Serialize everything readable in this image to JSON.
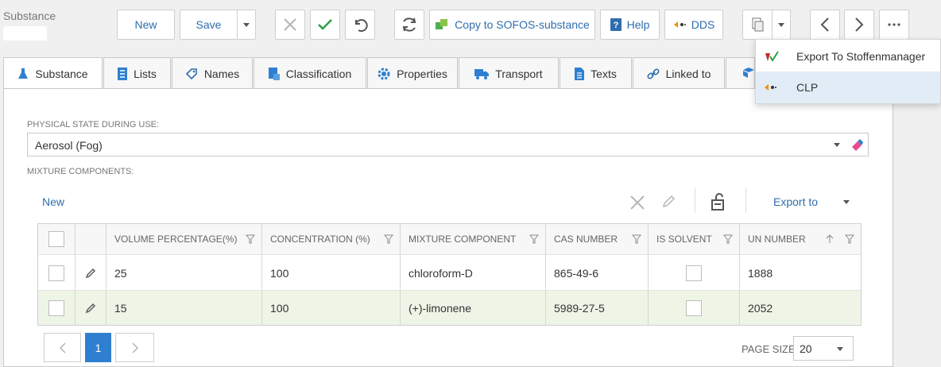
{
  "breadcrumb": {
    "title": "Substance"
  },
  "toolbar": {
    "new_label": "New",
    "save_label": "Save",
    "copy_label": "Copy to SOFOS-substance",
    "help_label": "Help",
    "dds_label": "DDS"
  },
  "tabs": [
    {
      "label": "Substance",
      "icon": "flask-icon"
    },
    {
      "label": "Lists",
      "icon": "list-icon"
    },
    {
      "label": "Names",
      "icon": "tag-icon"
    },
    {
      "label": "Classification",
      "icon": "classification-icon"
    },
    {
      "label": "Properties",
      "icon": "gear-icon"
    },
    {
      "label": "Transport",
      "icon": "truck-icon"
    },
    {
      "label": "Texts",
      "icon": "document-icon"
    },
    {
      "label": "Linked to",
      "icon": "link-icon"
    }
  ],
  "form": {
    "physical_state_label": "PHYSICAL STATE DURING USE:",
    "physical_state_value": "Aerosol (Fog)",
    "mixture_label": "MIXTURE COMPONENTS:"
  },
  "grid": {
    "new_label": "New",
    "export_label": "Export to",
    "columns": [
      "VOLUME PERCENTAGE(%)",
      "CONCENTRATION (%)",
      "MIXTURE COMPONENT",
      "CAS NUMBER",
      "IS SOLVENT",
      "UN NUMBER"
    ],
    "rows": [
      {
        "volume": "25",
        "concentration": "100",
        "component": "chloroform-D",
        "cas": "865-49-6",
        "un": "1888"
      },
      {
        "volume": "15",
        "concentration": "100",
        "component": "(+)-limonene",
        "cas": "5989-27-5",
        "un": "2052"
      }
    ],
    "selected_row_color": "#eef5e6"
  },
  "pager": {
    "current_page": "1",
    "page_size_label": "PAGE SIZE",
    "page_size_value": "20"
  },
  "dropdown_menu": {
    "items": [
      {
        "label": "Export To Stoffenmanager",
        "icon": "stoffenmanager-icon"
      },
      {
        "label": "CLP",
        "icon": "dds-icon"
      }
    ]
  },
  "colors": {
    "accent": "#2f6ead",
    "primary_button": "#2f7fd1",
    "check": "#2e9e3f"
  }
}
